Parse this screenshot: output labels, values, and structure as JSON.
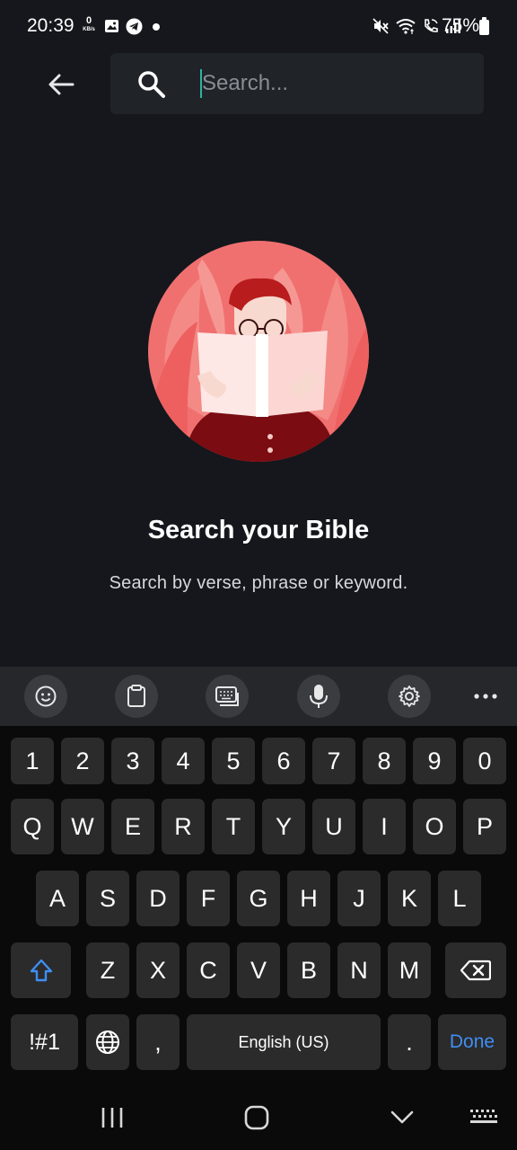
{
  "status_bar": {
    "time": "20:39",
    "net_speed_value": "0",
    "net_speed_unit": "KB/s",
    "battery": "75%"
  },
  "search": {
    "placeholder": "Search..."
  },
  "empty_state": {
    "title": "Search your Bible",
    "subtitle": "Search by verse, phrase or keyword."
  },
  "keyboard": {
    "number_row": [
      "1",
      "2",
      "3",
      "4",
      "5",
      "6",
      "7",
      "8",
      "9",
      "0"
    ],
    "row1": [
      "Q",
      "W",
      "E",
      "R",
      "T",
      "Y",
      "U",
      "I",
      "O",
      "P"
    ],
    "row2": [
      "A",
      "S",
      "D",
      "F",
      "G",
      "H",
      "J",
      "K",
      "L"
    ],
    "row3": [
      "Z",
      "X",
      "C",
      "V",
      "B",
      "N",
      "M"
    ],
    "symbols_label": "!#1",
    "comma_label": ",",
    "space_label": "English (US)",
    "period_label": ".",
    "done_label": "Done"
  },
  "colors": {
    "background": "#15171c",
    "search_box": "#202328",
    "accent_caret": "#2bb3a3",
    "done_blue": "#3f8ef3",
    "illustration_bg": "#f06b6b"
  }
}
